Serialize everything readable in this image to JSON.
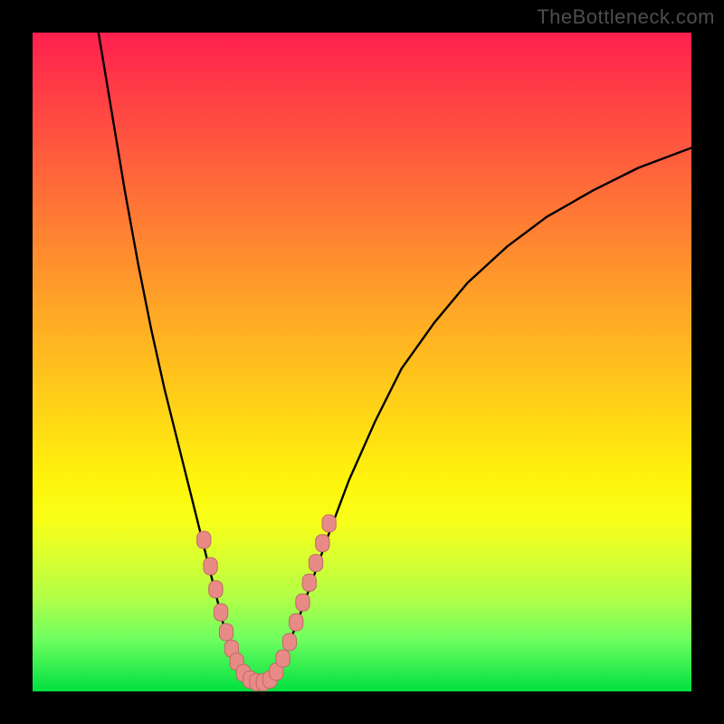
{
  "watermark": "TheBottleneck.com",
  "colors": {
    "curve": "#000000",
    "marker_fill": "#e88a86",
    "marker_stroke": "#c06a66",
    "frame": "#000000"
  },
  "chart_data": {
    "type": "line",
    "title": "",
    "xlabel": "",
    "ylabel": "",
    "xlim": [
      0,
      100
    ],
    "ylim": [
      0,
      100
    ],
    "grid": false,
    "legend": false,
    "series": [
      {
        "name": "left-branch",
        "x": [
          10.0,
          12.0,
          14.0,
          16.0,
          18.0,
          20.0,
          22.0,
          24.0,
          25.5,
          27.0,
          28.0,
          29.0,
          30.0,
          31.0,
          32.0
        ],
        "y": [
          100.0,
          88.0,
          76.0,
          65.0,
          55.0,
          46.0,
          38.0,
          30.0,
          24.0,
          18.0,
          14.0,
          10.0,
          6.0,
          3.5,
          2.0
        ]
      },
      {
        "name": "valley-floor",
        "x": [
          32.0,
          33.5,
          35.0,
          36.5
        ],
        "y": [
          2.0,
          1.2,
          1.2,
          2.0
        ]
      },
      {
        "name": "right-branch",
        "x": [
          36.5,
          38.0,
          40.0,
          42.5,
          45.0,
          48.0,
          52.0,
          56.0,
          61.0,
          66.0,
          72.0,
          78.0,
          85.0,
          92.0,
          100.0
        ],
        "y": [
          2.0,
          5.0,
          10.0,
          17.0,
          24.0,
          32.0,
          41.0,
          49.0,
          56.0,
          62.0,
          67.5,
          72.0,
          76.0,
          79.5,
          82.5
        ]
      }
    ],
    "markers": {
      "name": "highlighted-points",
      "radius_pct": 1.0,
      "points": [
        {
          "x": 26.0,
          "y": 23.0
        },
        {
          "x": 27.0,
          "y": 19.0
        },
        {
          "x": 27.8,
          "y": 15.5
        },
        {
          "x": 28.6,
          "y": 12.0
        },
        {
          "x": 29.4,
          "y": 9.0
        },
        {
          "x": 30.2,
          "y": 6.5
        },
        {
          "x": 31.0,
          "y": 4.5
        },
        {
          "x": 32.0,
          "y": 2.8
        },
        {
          "x": 33.0,
          "y": 1.8
        },
        {
          "x": 34.0,
          "y": 1.4
        },
        {
          "x": 35.0,
          "y": 1.4
        },
        {
          "x": 36.0,
          "y": 1.8
        },
        {
          "x": 37.0,
          "y": 3.0
        },
        {
          "x": 38.0,
          "y": 5.0
        },
        {
          "x": 39.0,
          "y": 7.5
        },
        {
          "x": 40.0,
          "y": 10.5
        },
        {
          "x": 41.0,
          "y": 13.5
        },
        {
          "x": 42.0,
          "y": 16.5
        },
        {
          "x": 43.0,
          "y": 19.5
        },
        {
          "x": 44.0,
          "y": 22.5
        },
        {
          "x": 45.0,
          "y": 25.5
        }
      ]
    }
  }
}
